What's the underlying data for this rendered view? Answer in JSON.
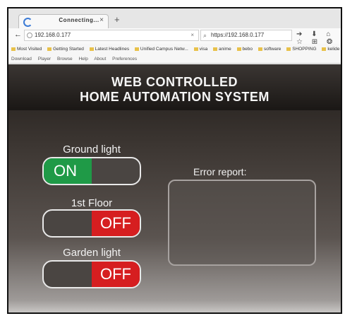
{
  "browser": {
    "tab_title": "Connecting...",
    "tab_close": "×",
    "new_tab": "+",
    "back": "←",
    "url": "192.168.0.177",
    "url_clear": "×",
    "search_icon": "⌕",
    "search_text": "https://192.168.0.177",
    "toolbar_icons": "➔ ⬇ ⌂ ☆ ⊞ ❂",
    "bookmarks": [
      "Most Visited",
      "Getting Started",
      "Latest Headlines",
      "Unified Campus Netw...",
      "visa",
      "anime",
      "bebo",
      "software",
      "SHOPPING",
      "kelide"
    ],
    "addons": [
      "Download",
      "Player",
      "Browse",
      "Help",
      "About",
      "Preferences"
    ]
  },
  "page": {
    "title_line1": "WEB CONTROLLED",
    "title_line2": "HOME AUTOMATION SYSTEM",
    "controls": [
      {
        "label": "Ground light",
        "state": "ON"
      },
      {
        "label": "1st Floor",
        "state": "OFF"
      },
      {
        "label": "Garden light",
        "state": "OFF"
      }
    ],
    "error_report_label": "Error report:",
    "error_report_text": ""
  }
}
